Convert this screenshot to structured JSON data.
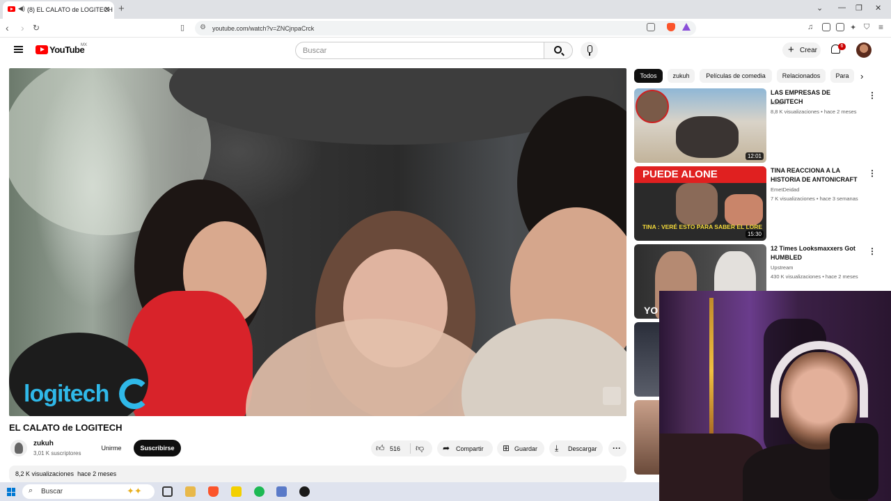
{
  "browser": {
    "tab_title": "(8) EL CALATO de LOGITECH",
    "url": "youtube.com/watch?v=ZNCjnpaCrck"
  },
  "header": {
    "logo_text": "YouTube",
    "region": "MX",
    "search_placeholder": "Buscar",
    "create_label": "Crear",
    "notifications_count": "6"
  },
  "video": {
    "title": "EL CALATO de LOGITECH",
    "overlay_brand": "logitech",
    "channel": "zukuh",
    "subscribers": "3,01 K suscriptores",
    "join_label": "Unirme",
    "subscribe_label": "Suscribirse",
    "likes": "516",
    "share_label": "Compartir",
    "save_label": "Guardar",
    "download_label": "Descargar",
    "views": "8,2 K visualizaciones",
    "age": "hace 2 meses"
  },
  "chips": [
    "Todos",
    "zukuh",
    "Películas de comedia",
    "Relacionados",
    "Para"
  ],
  "recommendations": [
    {
      "title": "LAS EMPRESAS DE LOGITECH",
      "channel": "zukuh",
      "meta": "8,8 K visualizaciones • hace 2 meses",
      "duration": "12:01",
      "thumb_top": "#8fb7d6",
      "thumb_bottom": "#c2b39a"
    },
    {
      "title": "TINA REACCIONA A LA HISTORIA DE ANTONICRAFT",
      "channel": "EmetDeidad",
      "meta": "7 K visualizaciones • hace 3 semanas",
      "duration": "15:30",
      "thumb_top": "#e02020",
      "thumb_bottom": "#2a2a2a",
      "overlay_top": "PUEDE ALONE",
      "overlay_bottom": "TINA : VERÉ ESTO PARA SABER EL LORE"
    },
    {
      "title": "12 Times Looksmaxxers Got HUMBLED",
      "channel": "Upstream",
      "meta": "430 K visualizaciones • hace 2 meses",
      "duration": "",
      "thumb_top": "#3a3a3a",
      "thumb_bottom": "#d8d0c8",
      "overlay_bottom": "YO"
    }
  ],
  "taskbar": {
    "search_label": "Buscar"
  },
  "colors": {
    "youtube_red": "#ff0000",
    "logitech_blue": "#2fb8e8"
  }
}
